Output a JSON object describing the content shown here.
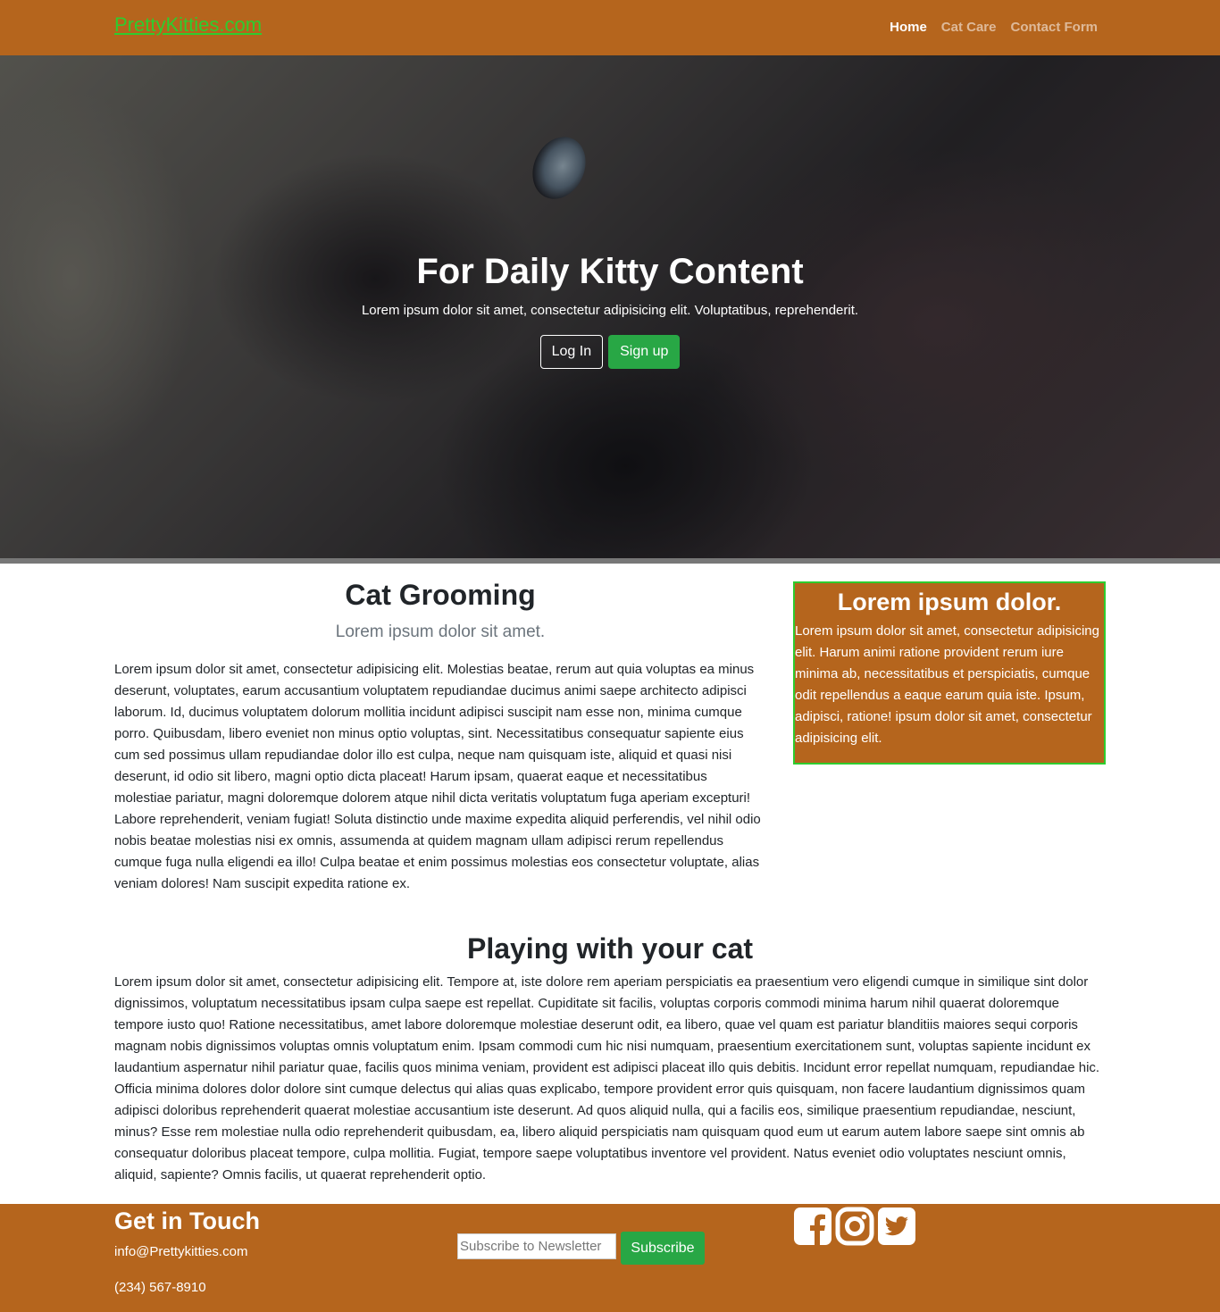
{
  "nav": {
    "brand": "PrettyKitties.com",
    "links": [
      {
        "label": "Home"
      },
      {
        "label": "Cat Care"
      },
      {
        "label": "Contact Form"
      }
    ]
  },
  "hero": {
    "title": "For Daily Kitty Content",
    "subtitle": "Lorem ipsum dolor sit amet, consectetur adipisicing elit. Voluptatibus, reprehenderit.",
    "login_label": "Log In",
    "signup_label": "Sign up"
  },
  "grooming": {
    "title": "Cat Grooming",
    "subtitle": "Lorem ipsum dolor sit amet.",
    "body": "Lorem ipsum dolor sit amet, consectetur adipisicing elit. Molestias beatae, rerum aut quia voluptas ea minus deserunt, voluptates, earum accusantium voluptatem repudiandae ducimus animi saepe architecto adipisci laborum. Id, ducimus voluptatem dolorum mollitia incidunt adipisci suscipit nam esse non, minima cumque porro. Quibusdam, libero eveniet non minus optio voluptas, sint. Necessitatibus consequatur sapiente eius cum sed possimus ullam repudiandae dolor illo est culpa, neque nam quisquam iste, aliquid et quasi nisi deserunt, id odio sit libero, magni optio dicta placeat! Harum ipsam, quaerat eaque et necessitatibus molestiae pariatur, magni doloremque dolorem atque nihil dicta veritatis voluptatum fuga aperiam excepturi! Labore reprehenderit, veniam fugiat! Soluta distinctio unde maxime expedita aliquid perferendis, vel nihil odio nobis beatae molestias nisi ex omnis, assumenda at quidem magnam ullam adipisci rerum repellendus cumque fuga nulla eligendi ea illo! Culpa beatae et enim possimus molestias eos consectetur voluptate, alias veniam dolores! Nam suscipit expedita ratione ex."
  },
  "sidebar": {
    "title": "Lorem ipsum dolor.",
    "body": "Lorem ipsum dolor sit amet, consectetur adipisicing elit. Harum animi ratione provident rerum iure minima ab, necessitatibus et perspiciatis, cumque odit repellendus a eaque earum quia iste. Ipsum, adipisci, ratione! ipsum dolor sit amet, consectetur adipisicing elit."
  },
  "playing": {
    "title": "Playing with your cat",
    "body": "Lorem ipsum dolor sit amet, consectetur adipisicing elit. Tempore at, iste dolore rem aperiam perspiciatis ea praesentium vero eligendi cumque in similique sint dolor dignissimos, voluptatum necessitatibus ipsam culpa saepe est repellat. Cupiditate sit facilis, voluptas corporis commodi minima harum nihil quaerat doloremque tempore iusto quo! Ratione necessitatibus, amet labore doloremque molestiae deserunt odit, ea libero, quae vel quam est pariatur blanditiis maiores sequi corporis magnam nobis dignissimos voluptas omnis voluptatum enim. Ipsam commodi cum hic nisi numquam, praesentium exercitationem sunt, voluptas sapiente incidunt ex laudantium aspernatur nihil pariatur quae, facilis quos minima veniam, provident est adipisci placeat illo quis debitis. Incidunt error repellat numquam, repudiandae hic. Officia minima dolores dolor dolore sint cumque delectus qui alias quas explicabo, tempore provident error quis quisquam, non facere laudantium dignissimos quam adipisci doloribus reprehenderit quaerat molestiae accusantium iste deserunt. Ad quos aliquid nulla, qui a facilis eos, similique praesentium repudiandae, nesciunt, minus? Esse rem molestiae nulla odio reprehenderit quibusdam, ea, libero aliquid perspiciatis nam quisquam quod eum ut earum autem labore saepe sint omnis ab consequatur doloribus placeat tempore, culpa mollitia. Fugiat, tempore saepe voluptatibus inventore vel provident. Natus eveniet odio voluptates nesciunt omnis, aliquid, sapiente? Omnis facilis, ut quaerat reprehenderit optio."
  },
  "footer": {
    "title": "Get in Touch",
    "email": "info@Prettykitties.com",
    "phone": "(234) 567-8910",
    "newsletter_placeholder": "Subscribe to Newsletter",
    "subscribe_label": "Subscribe",
    "social_icons": [
      "facebook-icon",
      "instagram-icon",
      "twitter-icon"
    ]
  },
  "colors": {
    "brand_orange": "#b5651d",
    "brand_green": "#2ecc2e",
    "button_green": "#28a745"
  }
}
